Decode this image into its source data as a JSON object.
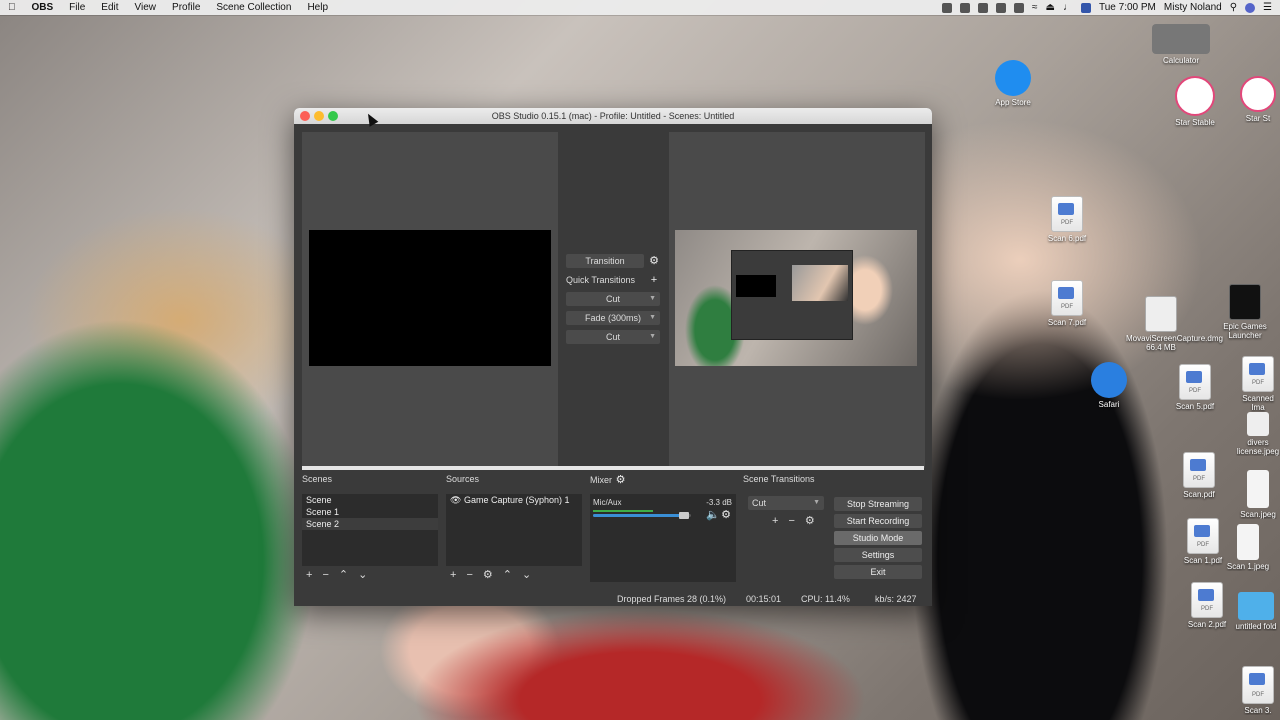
{
  "menubar": {
    "app_name": "OBS",
    "items": [
      "File",
      "Edit",
      "View",
      "Profile",
      "Scene Collection",
      "Help"
    ],
    "clock": "Tue 7:00 PM",
    "user": "Misty Noland"
  },
  "desktop_icons": {
    "calculator": "Calculator",
    "app_store": "App Store",
    "star_stable": "Star Stable",
    "star_stable_2": "Star St",
    "scan6": "Scan 6.pdf",
    "scan7": "Scan 7.pdf",
    "movavi": "MovaviScreenCapture.dmg",
    "movavi_size": "66.4 MB",
    "epic": "Epic Games Launcher",
    "safari": "Safari",
    "scan5": "Scan 5.pdf",
    "scanned": "Scanned Ima",
    "divers": "divers license.jpeg",
    "scan": "Scan.pdf",
    "scan_jpeg": "Scan.jpeg",
    "scan1": "Scan 1.pdf",
    "scan1_jpeg": "Scan 1.jpeg",
    "scan2": "Scan 2.pdf",
    "untitled": "untitled fold",
    "scan3": "Scan 3."
  },
  "window": {
    "title": "OBS Studio 0.15.1 (mac) - Profile: Untitled - Scenes: Untitled"
  },
  "transitions_center": {
    "transition_label": "Transition",
    "quick_transitions_label": "Quick Transitions",
    "quick": [
      "Cut",
      "Fade (300ms)",
      "Cut"
    ]
  },
  "scenes": {
    "label": "Scenes",
    "items": [
      "Scene",
      "Scene 1",
      "Scene 2"
    ],
    "selected_index": 2
  },
  "sources": {
    "label": "Sources",
    "items": [
      "Game Capture (Syphon) 1"
    ]
  },
  "mixer": {
    "label": "Mixer",
    "channel": "Mic/Aux",
    "db": "-3.3 dB",
    "volume_fraction": 0.9
  },
  "scene_transitions": {
    "label": "Scene Transitions",
    "selected": "Cut"
  },
  "controls": {
    "stop_streaming": "Stop Streaming",
    "start_recording": "Start Recording",
    "studio_mode": "Studio Mode",
    "settings": "Settings",
    "exit": "Exit"
  },
  "status": {
    "dropped_frames": "Dropped Frames 28 (0.1%)",
    "time": "00:15:01",
    "cpu": "CPU: 11.4%",
    "kbs": "kb/s: 2427"
  },
  "colors": {
    "close": "#fc5f57",
    "minimize": "#fdbc2e",
    "zoom": "#34c84a",
    "mixer_green": "#3fae49",
    "mixer_blue": "#3a8fd6"
  }
}
